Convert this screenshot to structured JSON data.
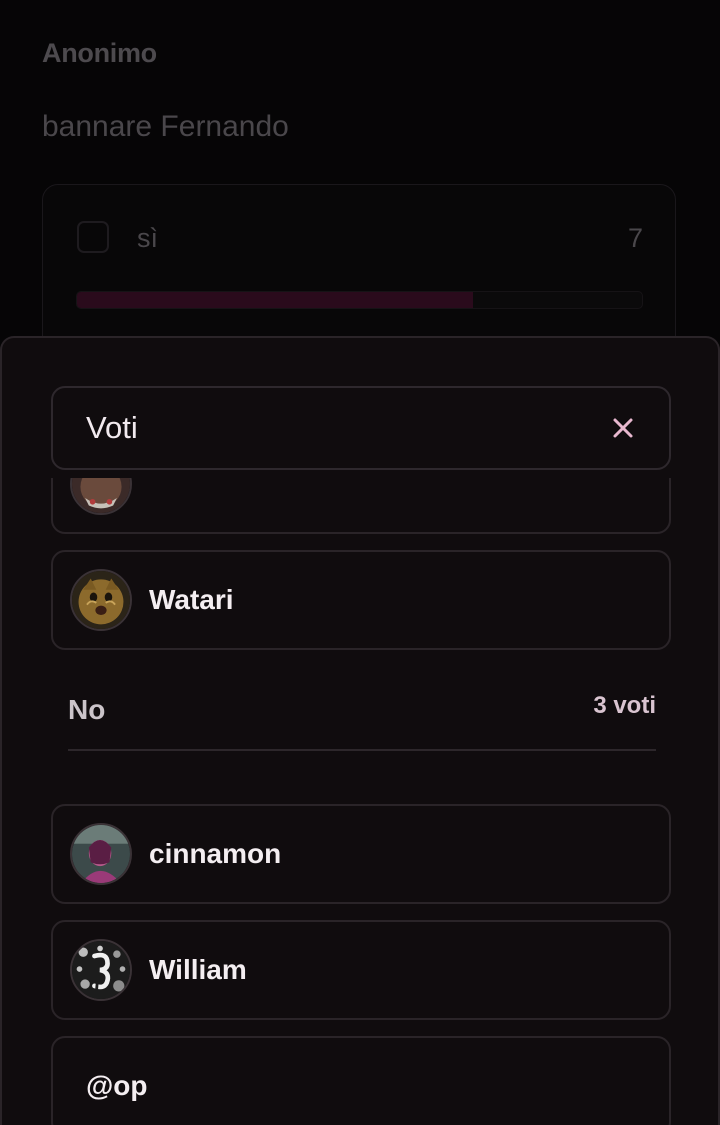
{
  "background_poll": {
    "author": "Anonimo",
    "question": "bannare Fernando",
    "option": {
      "label": "sì",
      "count": "7",
      "fill_fraction": 0.7
    }
  },
  "sheet": {
    "title": "Voti",
    "close_icon": "close-icon",
    "sections": [
      {
        "voters": [
          {
            "name": "",
            "avatar": "avatar-partial"
          },
          {
            "name": "Watari",
            "avatar": "cat-avatar"
          }
        ]
      },
      {
        "title": "No",
        "count_label": "3 voti",
        "voters": [
          {
            "name": "cinnamon",
            "avatar": "portrait-avatar"
          },
          {
            "name": "William",
            "avatar": "abstract-avatar"
          },
          {
            "name": "@op",
            "avatar": ""
          }
        ]
      }
    ]
  },
  "colors": {
    "background": "#060506",
    "sheet": "#100c0e",
    "border": "#2a2428",
    "accent": "#e8b8cf",
    "progress_fill": "#2a0b1c"
  }
}
